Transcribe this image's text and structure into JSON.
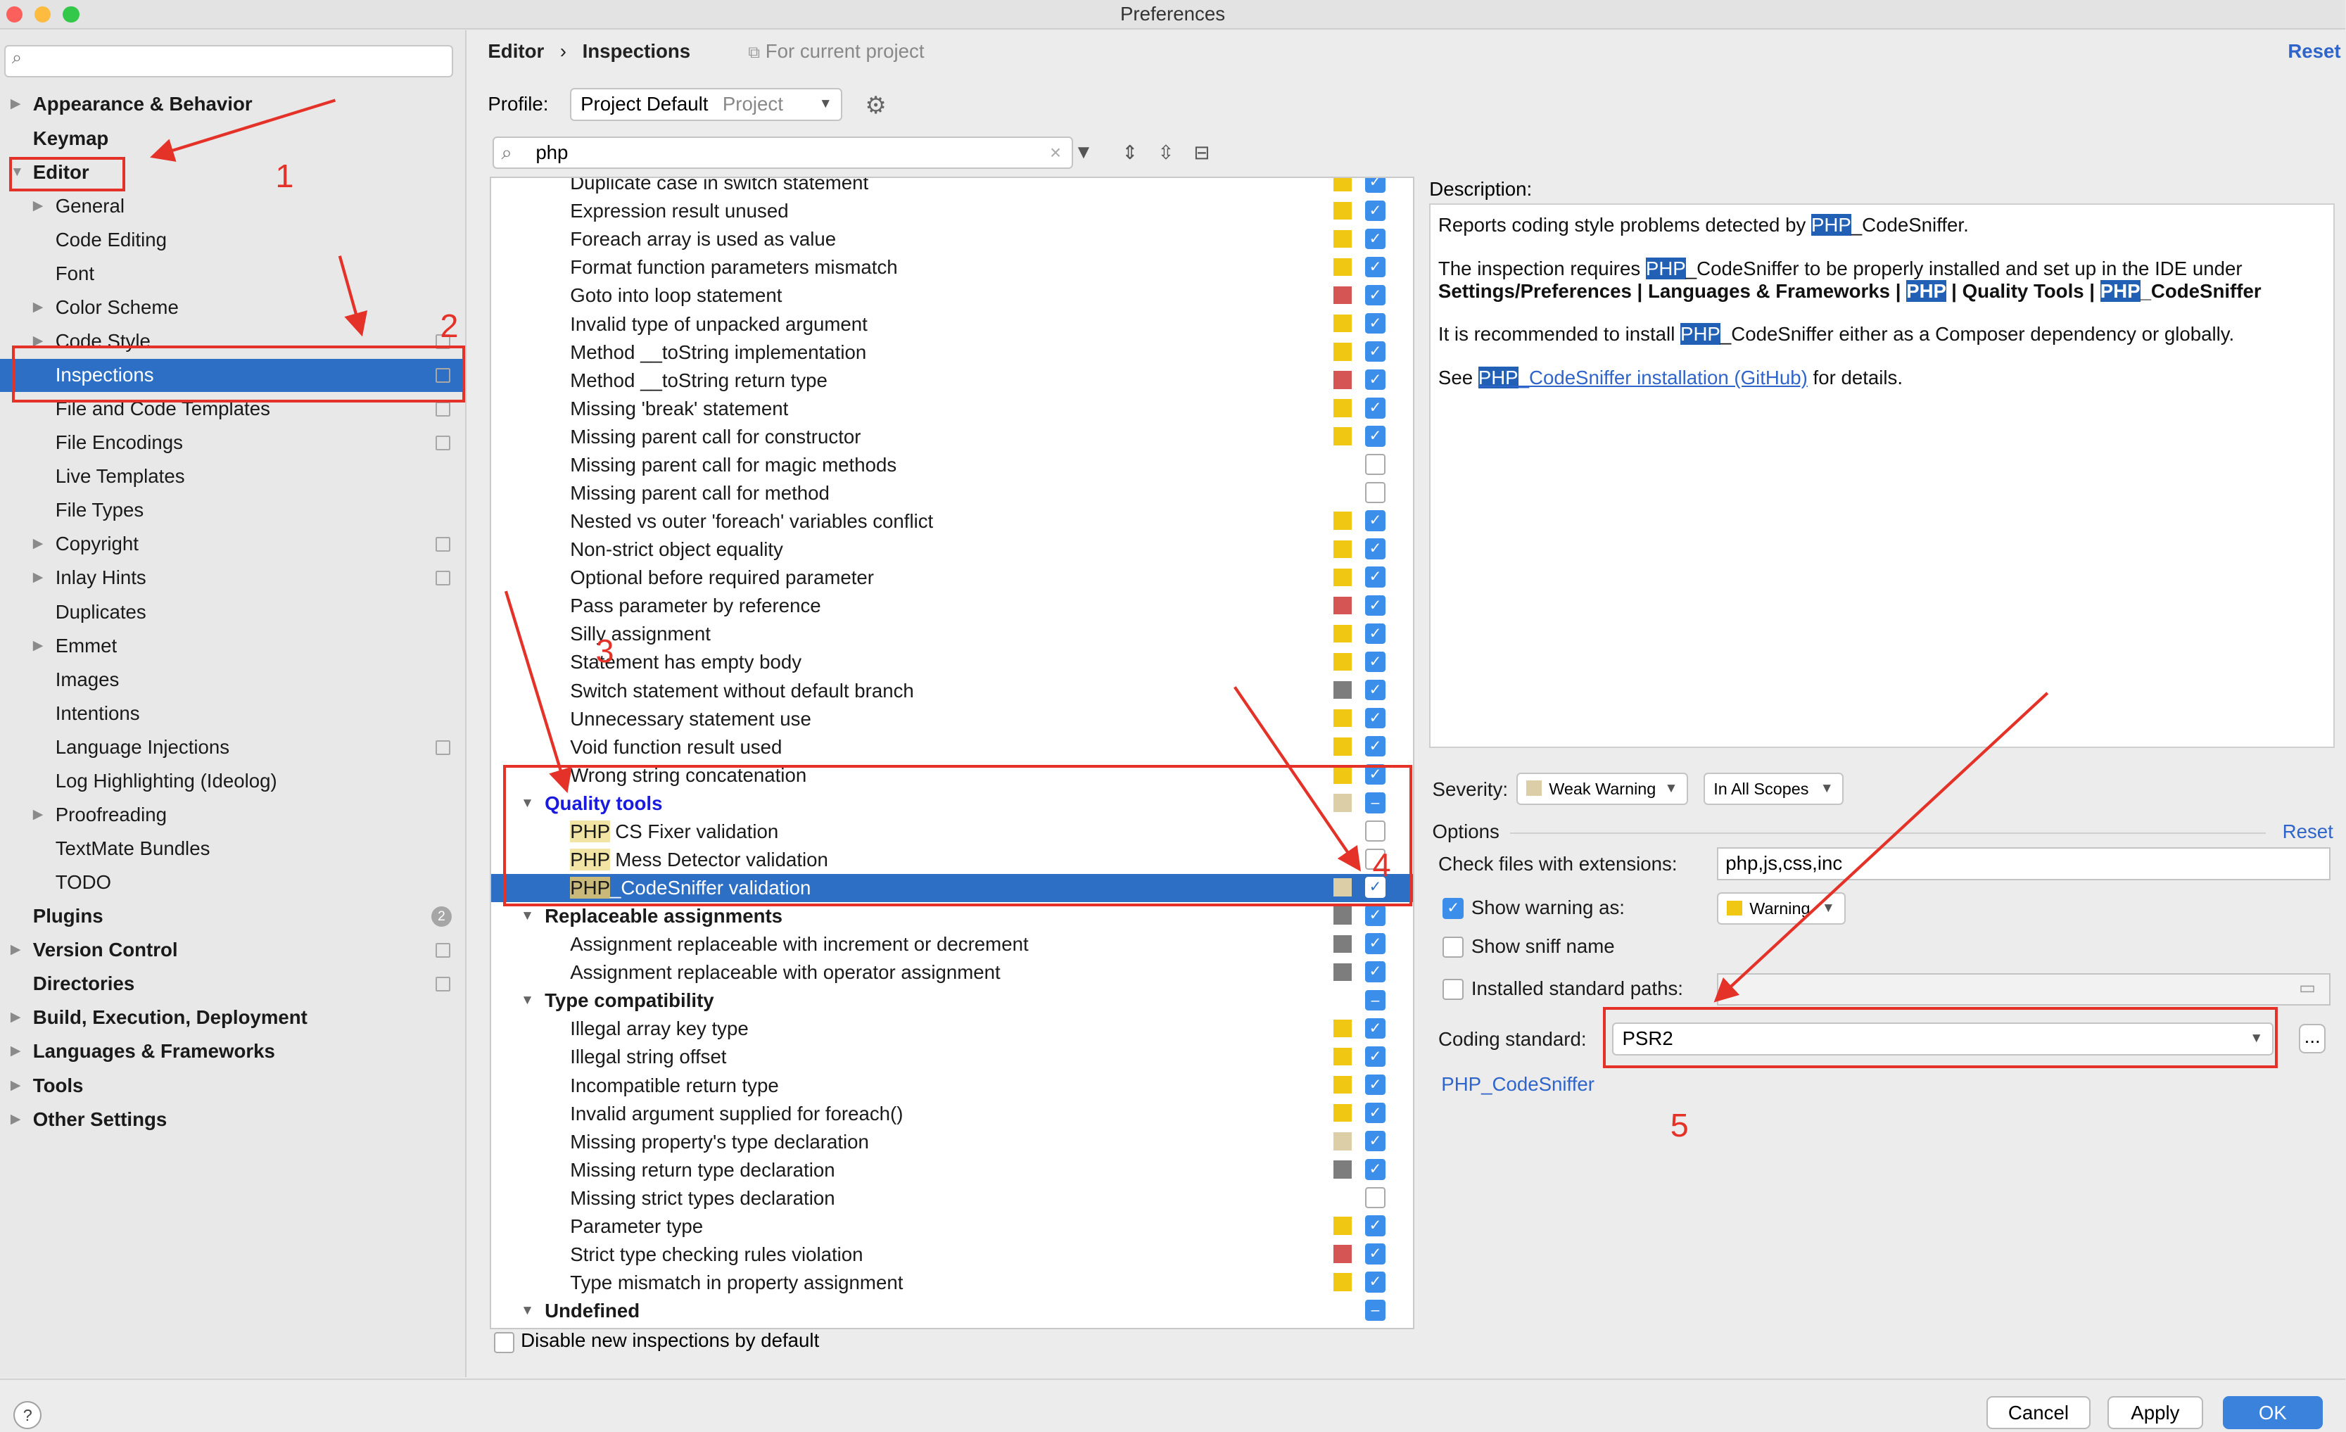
{
  "window": {
    "title": "Preferences"
  },
  "sidebar": {
    "items": [
      {
        "label": "Appearance & Behavior",
        "level": 0,
        "bold": true,
        "arrow": "▶"
      },
      {
        "label": "Keymap",
        "level": 0,
        "bold": true,
        "arrow": ""
      },
      {
        "label": "Editor",
        "level": 0,
        "bold": true,
        "arrow": "▼"
      },
      {
        "label": "General",
        "level": 1,
        "bold": false,
        "arrow": "▶"
      },
      {
        "label": "Code Editing",
        "level": 1,
        "bold": false,
        "arrow": ""
      },
      {
        "label": "Font",
        "level": 1,
        "bold": false,
        "arrow": ""
      },
      {
        "label": "Color Scheme",
        "level": 1,
        "bold": false,
        "arrow": "▶"
      },
      {
        "label": "Code Style",
        "level": 1,
        "bold": false,
        "arrow": "▶",
        "proj": true
      },
      {
        "label": "Inspections",
        "level": 1,
        "bold": false,
        "arrow": "",
        "selected": true,
        "proj": true
      },
      {
        "label": "File and Code Templates",
        "level": 1,
        "bold": false,
        "arrow": "",
        "proj": true
      },
      {
        "label": "File Encodings",
        "level": 1,
        "bold": false,
        "arrow": "",
        "proj": true
      },
      {
        "label": "Live Templates",
        "level": 1,
        "bold": false,
        "arrow": ""
      },
      {
        "label": "File Types",
        "level": 1,
        "bold": false,
        "arrow": ""
      },
      {
        "label": "Copyright",
        "level": 1,
        "bold": false,
        "arrow": "▶",
        "proj": true
      },
      {
        "label": "Inlay Hints",
        "level": 1,
        "bold": false,
        "arrow": "▶",
        "proj": true
      },
      {
        "label": "Duplicates",
        "level": 1,
        "bold": false,
        "arrow": ""
      },
      {
        "label": "Emmet",
        "level": 1,
        "bold": false,
        "arrow": "▶"
      },
      {
        "label": "Images",
        "level": 1,
        "bold": false,
        "arrow": ""
      },
      {
        "label": "Intentions",
        "level": 1,
        "bold": false,
        "arrow": ""
      },
      {
        "label": "Language Injections",
        "level": 1,
        "bold": false,
        "arrow": "",
        "proj": true
      },
      {
        "label": "Log Highlighting (Ideolog)",
        "level": 1,
        "bold": false,
        "arrow": ""
      },
      {
        "label": "Proofreading",
        "level": 1,
        "bold": false,
        "arrow": "▶"
      },
      {
        "label": "TextMate Bundles",
        "level": 1,
        "bold": false,
        "arrow": ""
      },
      {
        "label": "TODO",
        "level": 1,
        "bold": false,
        "arrow": ""
      },
      {
        "label": "Plugins",
        "level": 0,
        "bold": true,
        "arrow": "",
        "badge": "2"
      },
      {
        "label": "Version Control",
        "level": 0,
        "bold": true,
        "arrow": "▶",
        "proj": true
      },
      {
        "label": "Directories",
        "level": 0,
        "bold": true,
        "arrow": "",
        "proj": true
      },
      {
        "label": "Build, Execution, Deployment",
        "level": 0,
        "bold": true,
        "arrow": "▶"
      },
      {
        "label": "Languages & Frameworks",
        "level": 0,
        "bold": true,
        "arrow": "▶"
      },
      {
        "label": "Tools",
        "level": 0,
        "bold": true,
        "arrow": "▶"
      },
      {
        "label": "Other Settings",
        "level": 0,
        "bold": true,
        "arrow": "▶"
      }
    ]
  },
  "header": {
    "crumb1": "Editor",
    "sep": "›",
    "crumb2": "Inspections",
    "scope_note": "For current project",
    "reset": "Reset",
    "profile_label": "Profile:",
    "profile_value": "Project Default",
    "profile_kind": "Project",
    "search_value": "php"
  },
  "colors": {
    "yellow": "#f0c814",
    "red": "#d55454",
    "gray": "#7d7d7d",
    "tan": "#dccfa7",
    "none": "transparent"
  },
  "inspections": [
    {
      "text": "Duplicate case in switch statement",
      "sev": "yellow",
      "check": "on"
    },
    {
      "text": "Expression result unused",
      "sev": "yellow",
      "check": "on"
    },
    {
      "text": "Foreach array is used as value",
      "sev": "yellow",
      "check": "on"
    },
    {
      "text": "Format function parameters mismatch",
      "sev": "yellow",
      "check": "on"
    },
    {
      "text": "Goto into loop statement",
      "sev": "red",
      "check": "on"
    },
    {
      "text": "Invalid type of unpacked argument",
      "sev": "yellow",
      "check": "on"
    },
    {
      "text": "Method __toString implementation",
      "sev": "yellow",
      "check": "on"
    },
    {
      "text": "Method __toString return type",
      "sev": "red",
      "check": "on"
    },
    {
      "text": "Missing 'break' statement",
      "sev": "yellow",
      "check": "on"
    },
    {
      "text": "Missing parent call for constructor",
      "sev": "yellow",
      "check": "on"
    },
    {
      "text": "Missing parent call for magic methods",
      "sev": "none",
      "check": "off"
    },
    {
      "text": "Missing parent call for method",
      "sev": "none",
      "check": "off"
    },
    {
      "text": "Nested vs outer 'foreach' variables conflict",
      "sev": "yellow",
      "check": "on"
    },
    {
      "text": "Non-strict object equality",
      "sev": "yellow",
      "check": "on"
    },
    {
      "text": "Optional before required parameter",
      "sev": "yellow",
      "check": "on"
    },
    {
      "text": "Pass parameter by reference",
      "sev": "red",
      "check": "on"
    },
    {
      "text": "Silly assignment",
      "sev": "yellow",
      "check": "on"
    },
    {
      "text": "Statement has empty body",
      "sev": "yellow",
      "check": "on"
    },
    {
      "text": "Switch statement without default branch",
      "sev": "gray",
      "check": "on"
    },
    {
      "text": "Unnecessary statement use",
      "sev": "yellow",
      "check": "on"
    },
    {
      "text": "Void function result used",
      "sev": "yellow",
      "check": "on"
    },
    {
      "text": "Wrong string concatenation",
      "sev": "yellow",
      "check": "on"
    },
    {
      "group": "Quality tools",
      "blue": true,
      "sev": "tan",
      "check": "partial"
    },
    {
      "hl": "PHP",
      "text": " CS Fixer validation",
      "sev": "none",
      "check": "off"
    },
    {
      "hl": "PHP",
      "text": " Mess Detector validation",
      "sev": "none",
      "check": "off"
    },
    {
      "hl": "PHP",
      "text": "_CodeSniffer validation",
      "sev": "tan",
      "check": "on",
      "selected": true
    },
    {
      "group": "Replaceable assignments",
      "sev": "gray",
      "check": "on"
    },
    {
      "text": "Assignment replaceable with increment or decrement",
      "sev": "gray",
      "check": "on"
    },
    {
      "text": "Assignment replaceable with operator assignment",
      "sev": "gray",
      "check": "on"
    },
    {
      "group": "Type compatibility",
      "sev": "none",
      "check": "partial"
    },
    {
      "text": "Illegal array key type",
      "sev": "yellow",
      "check": "on"
    },
    {
      "text": "Illegal string offset",
      "sev": "yellow",
      "check": "on"
    },
    {
      "text": "Incompatible return type",
      "sev": "yellow",
      "check": "on"
    },
    {
      "text": "Invalid argument supplied for foreach()",
      "sev": "yellow",
      "check": "on"
    },
    {
      "text": "Missing property's type declaration",
      "sev": "tan",
      "check": "on"
    },
    {
      "text": "Missing return type declaration",
      "sev": "gray",
      "check": "on"
    },
    {
      "text": "Missing strict types declaration",
      "sev": "none",
      "check": "off"
    },
    {
      "text": "Parameter type",
      "sev": "yellow",
      "check": "on"
    },
    {
      "text": "Strict type checking rules violation",
      "sev": "red",
      "check": "on"
    },
    {
      "text": "Type mismatch in property assignment",
      "sev": "yellow",
      "check": "on"
    },
    {
      "group": "Undefined",
      "sev": "none",
      "check": "partial"
    }
  ],
  "disable_new": "Disable new inspections by default",
  "description": {
    "label": "Description:",
    "p1_a": "Reports coding style problems detected by ",
    "hl": "PHP",
    "p1_b": "_CodeSniffer.",
    "p2_a": "The inspection requires ",
    "p2_b": "_CodeSniffer to be properly installed and set up in the IDE under",
    "p3_a": "Settings/Preferences | Languages & Frameworks | ",
    "p3_b": " | Quality Tools | ",
    "p3_c": "_CodeSniffer",
    "p4_a": "It is recommended to install ",
    "p4_b": "_CodeSniffer either as a Composer dependency or globally.",
    "p5_a": "See ",
    "p5_link": "_CodeSniffer installation (GitHub)",
    "p5_b": " for details."
  },
  "severity": {
    "label": "Severity:",
    "value": "Weak Warning",
    "scope": "In All Scopes"
  },
  "options": {
    "title": "Options",
    "reset": "Reset",
    "ext_label": "Check files with extensions:",
    "ext_value": "php,js,css,inc",
    "show_warning_label": "Show warning as:",
    "show_warning_value": "Warning",
    "sniff_label": "Show sniff name",
    "paths_label": "Installed standard paths:",
    "coding_label": "Coding standard:",
    "coding_value": "PSR2",
    "more": "...",
    "link": "PHP_CodeSniffer"
  },
  "buttons": {
    "help": "?",
    "cancel": "Cancel",
    "apply": "Apply",
    "ok": "OK"
  },
  "annotations": [
    "1",
    "2",
    "3",
    "4",
    "5"
  ]
}
